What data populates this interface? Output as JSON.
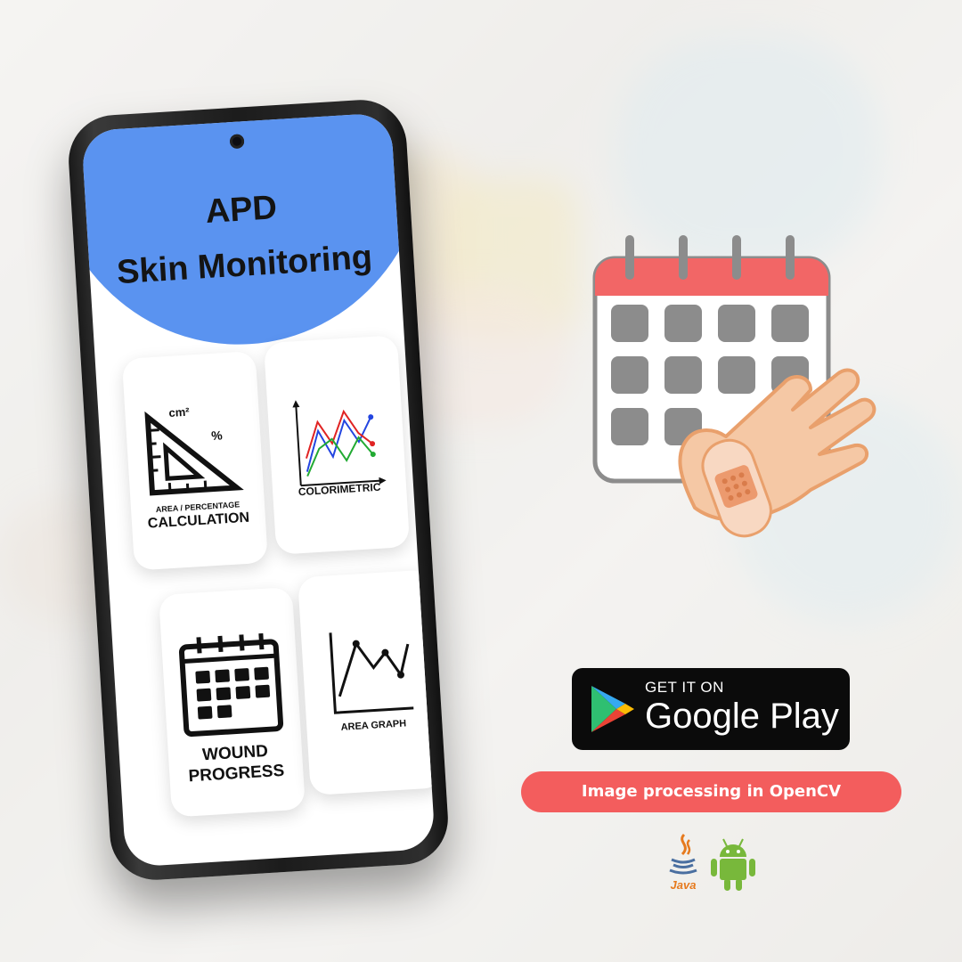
{
  "app": {
    "title_line1": "APD",
    "title_line2": "Skin Monitoring"
  },
  "features": [
    {
      "id": "area",
      "label_small": "AREA / PERCENTAGE",
      "label_big": "CALCULATION",
      "unit_cm": "cm²",
      "unit_pct": "%",
      "icon": "triangle-ruler-icon"
    },
    {
      "id": "colorimetric",
      "label": "COLORIMETRIC",
      "icon": "multi-line-chart-icon"
    },
    {
      "id": "wound",
      "label_line1": "WOUND",
      "label_line2": "PROGRESS",
      "icon": "calendar-icon"
    },
    {
      "id": "area-graph",
      "label": "AREA GRAPH",
      "icon": "line-graph-icon"
    }
  ],
  "store_badge": {
    "get_it_on": "GET IT ON",
    "store": "Google Play",
    "icon": "google-play-icon"
  },
  "tagline": "Image processing in OpenCV",
  "tech": {
    "java_label": "Java",
    "java_icon": "java-cup-icon",
    "android_icon": "android-robot-icon"
  },
  "colors": {
    "header_blue": "#5a93f0",
    "accent_red": "#f35d5d",
    "calendar_red": "#f26666",
    "calendar_gray": "#8c8c8c",
    "hand_orange": "#f5c8a5",
    "java_orange": "#e67a1e",
    "android_green": "#78b83b"
  }
}
